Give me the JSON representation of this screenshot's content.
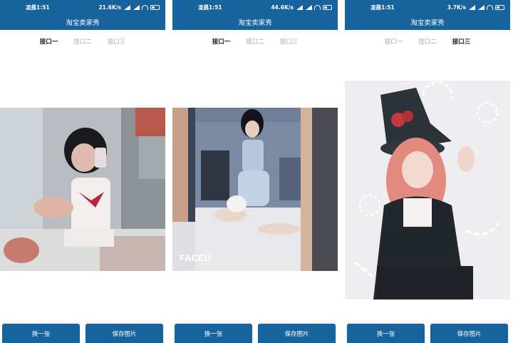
{
  "app_title": "淘宝卖家秀",
  "tabs": [
    "接口一",
    "接口二",
    "接口三"
  ],
  "buttons": {
    "next": "换一张",
    "save": "保存图片"
  },
  "screens": [
    {
      "time": "凌晨1:51",
      "speed": "21.6K/s",
      "active_tab": 0
    },
    {
      "time": "凌晨1:51",
      "speed": "44.6K/s",
      "active_tab": 0
    },
    {
      "time": "凌晨1:51",
      "speed": "3.7K/s",
      "active_tab": 2
    }
  ],
  "photo_watermark": "FACEU",
  "colors": {
    "primary": "#16639d",
    "tab_active": "#222222",
    "tab_inactive": "#a8a8a8"
  }
}
